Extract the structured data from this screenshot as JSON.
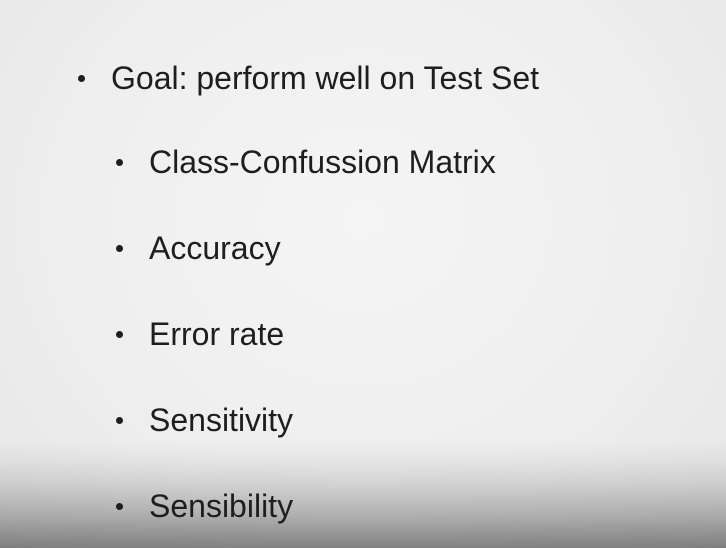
{
  "slide": {
    "main_bullet": "Goal: perform well on Test Set",
    "sub_bullets": [
      "Class-Confussion Matrix",
      "Accuracy",
      "Error rate",
      "Sensitivity",
      "Sensibility"
    ]
  }
}
